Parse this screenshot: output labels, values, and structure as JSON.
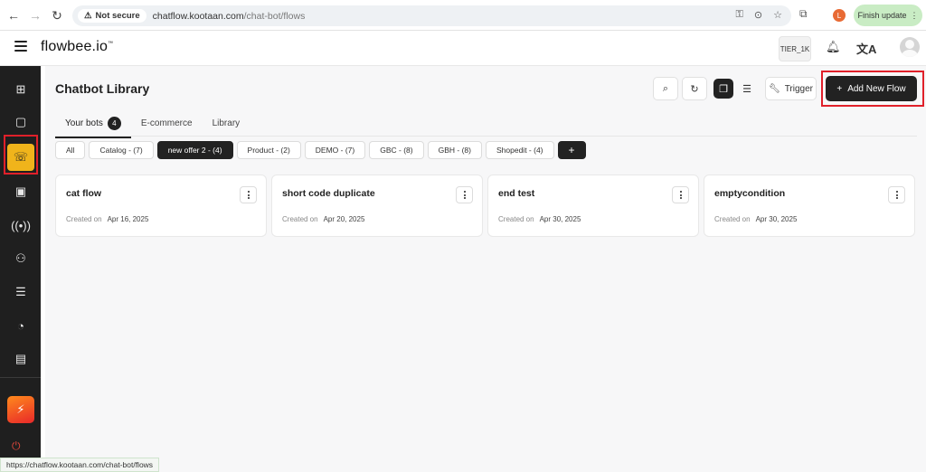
{
  "browser": {
    "secure_label": "Not secure",
    "url_host": "chatflow.kootaan.com",
    "url_path": "/chat-bot/flows",
    "profile_initial": "L",
    "finish_update_label": "Finish update",
    "status_url": "https://chatflow.kootaan.com/chat-bot/flows"
  },
  "header": {
    "logo_text": "flowbee.io",
    "logo_mark": "™",
    "tier_label": "TIER_1K"
  },
  "sidebar": {
    "accent_color": "#f0b41b",
    "items": [
      {
        "name": "dashboard-icon",
        "glyph": "⊞"
      },
      {
        "name": "chat-icon",
        "glyph": "🗨"
      },
      {
        "name": "chatbot-icon",
        "glyph": "🤖"
      },
      {
        "name": "contacts-icon",
        "glyph": "👤"
      },
      {
        "name": "broadcast-icon",
        "glyph": "📡"
      },
      {
        "name": "users-icon",
        "glyph": "👥"
      },
      {
        "name": "settings-sliders-icon",
        "glyph": "☰"
      },
      {
        "name": "analytics-icon",
        "glyph": "◔"
      },
      {
        "name": "store-icon",
        "glyph": "🏪"
      }
    ]
  },
  "main": {
    "title": "Chatbot Library",
    "trigger_label": "Trigger",
    "add_flow_label": "Add New Flow",
    "tabs": [
      {
        "label": "Your bots",
        "badge": "4",
        "active": true
      },
      {
        "label": "E-commerce"
      },
      {
        "label": "Library"
      }
    ],
    "filters": [
      {
        "label": "All"
      },
      {
        "label": "Catalog - (7)"
      },
      {
        "label": "new offer 2 - (4)",
        "active": true
      },
      {
        "label": "Product - (2)"
      },
      {
        "label": "DEMO - (7)"
      },
      {
        "label": "GBC - (8)"
      },
      {
        "label": "GBH - (8)"
      },
      {
        "label": "Shopedit - (4)"
      }
    ],
    "add_filter_label": "+",
    "cards": [
      {
        "title": "cat flow",
        "created_label": "Created on",
        "date": "Apr 16, 2025"
      },
      {
        "title": "short code duplicate",
        "created_label": "Created on",
        "date": "Apr 20, 2025"
      },
      {
        "title": "end test",
        "created_label": "Created on",
        "date": "Apr 30, 2025"
      },
      {
        "title": "emptycondition",
        "created_label": "Created on",
        "date": "Apr 30, 2025"
      }
    ]
  }
}
